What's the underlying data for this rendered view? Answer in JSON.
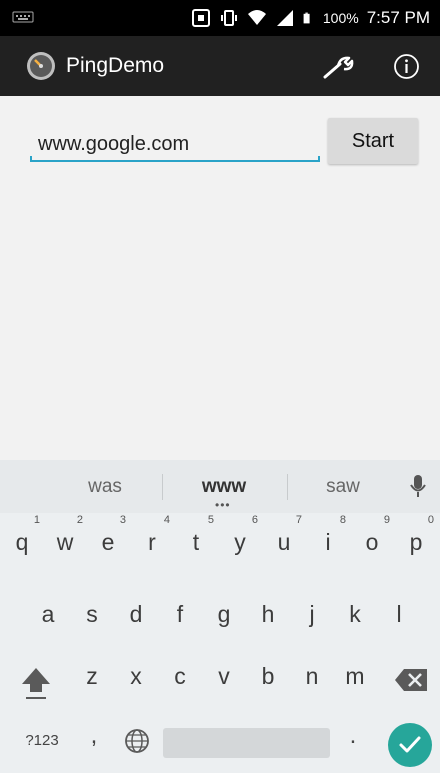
{
  "status_bar": {
    "battery": "100%",
    "time": "7:57 PM"
  },
  "app_bar": {
    "title": "PingDemo",
    "icons": [
      "speedometer-icon",
      "wrench-icon",
      "info-icon"
    ]
  },
  "form": {
    "url_value": "www.google.com",
    "start_label": "Start"
  },
  "keyboard": {
    "suggestions": [
      "was",
      "www",
      "saw"
    ],
    "row1": [
      {
        "key": "q",
        "num": "1"
      },
      {
        "key": "w",
        "num": "2"
      },
      {
        "key": "e",
        "num": "3"
      },
      {
        "key": "r",
        "num": "4"
      },
      {
        "key": "t",
        "num": "5"
      },
      {
        "key": "y",
        "num": "6"
      },
      {
        "key": "u",
        "num": "7"
      },
      {
        "key": "i",
        "num": "8"
      },
      {
        "key": "o",
        "num": "9"
      },
      {
        "key": "p",
        "num": "0"
      }
    ],
    "row2": [
      "a",
      "s",
      "d",
      "f",
      "g",
      "h",
      "j",
      "k",
      "l"
    ],
    "row3": [
      "z",
      "x",
      "c",
      "v",
      "b",
      "n",
      "m"
    ],
    "symbols_label": "?123",
    "comma_label": ",",
    "period_label": ".",
    "accent_color": "#26a69a"
  }
}
